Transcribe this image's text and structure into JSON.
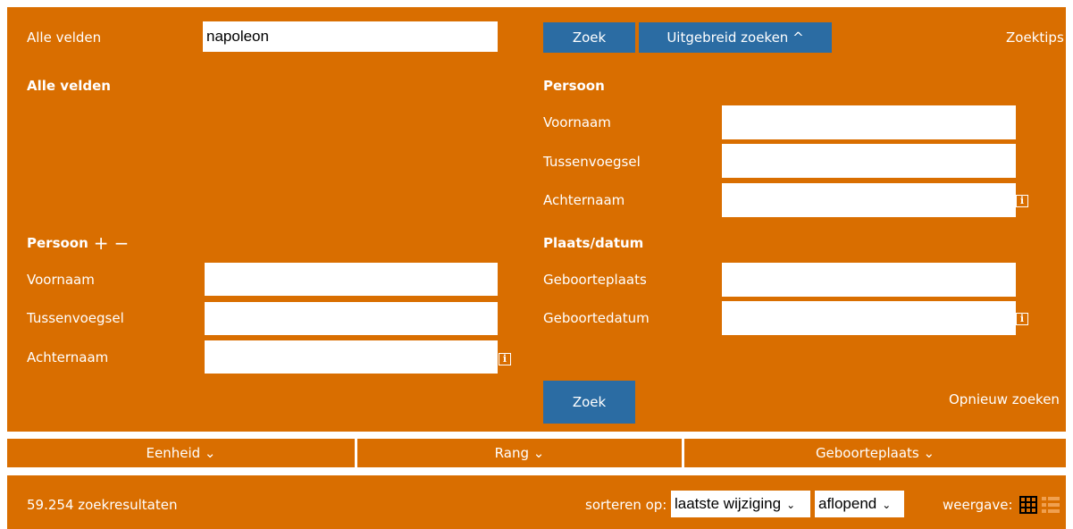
{
  "top": {
    "label": "Alle velden",
    "value": "napoleon",
    "search_button": "Zoek",
    "advanced_button": "Uitgebreid zoeken ^",
    "tips_link": "Zoektips"
  },
  "left": {
    "all_fields_heading": "Alle velden",
    "person_heading": "Persoon",
    "plus": "+",
    "minus": "−",
    "fields": [
      "Voornaam",
      "Tussenvoegsel",
      "Achternaam"
    ]
  },
  "right": {
    "person_heading": "Persoon",
    "person_fields": [
      "Voornaam",
      "Tussenvoegsel",
      "Achternaam"
    ],
    "place_heading": "Plaats/datum",
    "place_fields": [
      "Geboorteplaats",
      "Geboortedatum"
    ],
    "search_button": "Zoek",
    "reset_link": "Opnieuw zoeken"
  },
  "info_glyph": "i",
  "filters": [
    {
      "label": "Eenheid ⌄"
    },
    {
      "label": "Rang ⌄"
    },
    {
      "label": "Geboorteplaats ⌄"
    }
  ],
  "results": {
    "count_text": "59.254 zoekresultaten",
    "sort_label": "sorteren op:",
    "sort_value": "laatste wijziging",
    "order_value": "aflopend",
    "view_label": "weergave:"
  },
  "colors": {
    "panel": "#d96e00",
    "button": "#2b6ca3",
    "grid_icon": "#000000"
  },
  "icons": [
    "grid-view-icon",
    "list-view-icon",
    "info-icon",
    "chevron-down-icon"
  ]
}
